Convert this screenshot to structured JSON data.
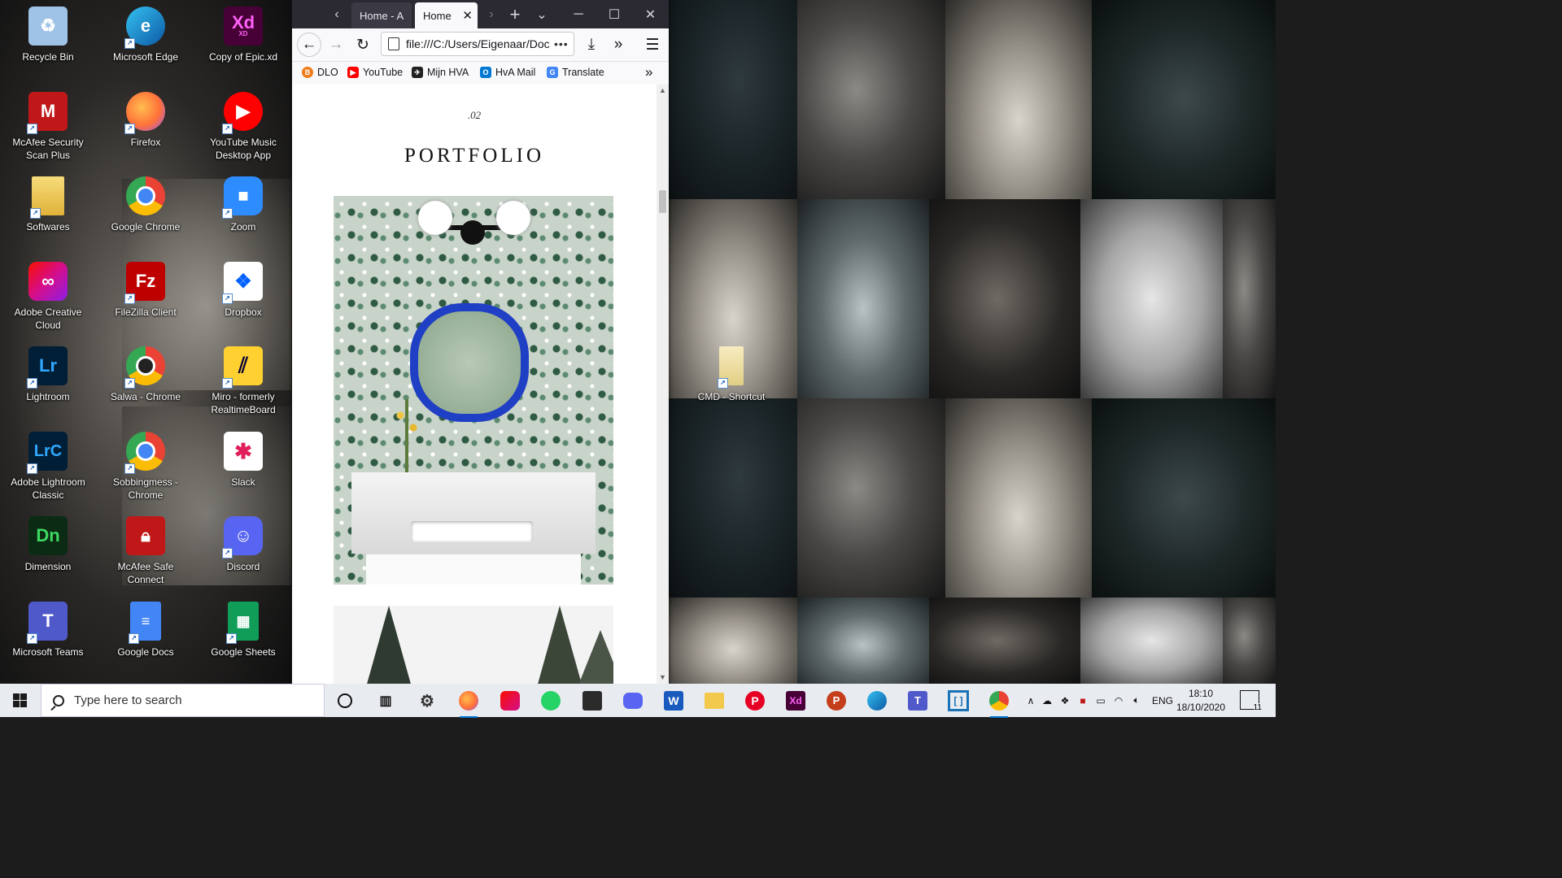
{
  "desktop": {
    "icons": [
      {
        "label": "Recycle Bin",
        "icon": "recycle-bin-icon",
        "color": "#9fc3e6"
      },
      {
        "label": "Microsoft Edge",
        "icon": "edge-icon",
        "color": "#1b8bd6"
      },
      {
        "label": "Copy of Epic.xd",
        "icon": "xd-file-icon",
        "color": "#470137"
      },
      {
        "label": "McAfee Security Scan Plus",
        "icon": "mcafee-scan-icon",
        "color": "#c01818"
      },
      {
        "label": "Firefox",
        "icon": "firefox-icon",
        "color": "#ff7139"
      },
      {
        "label": "YouTube Music Desktop App",
        "icon": "youtube-music-icon",
        "color": "#ff0000"
      },
      {
        "label": "Softwares",
        "icon": "folder-icon",
        "color": "#e8c14b"
      },
      {
        "label": "Google Chrome",
        "icon": "chrome-icon",
        "color": "#4285f4"
      },
      {
        "label": "Zoom",
        "icon": "zoom-icon",
        "color": "#2d8cff"
      },
      {
        "label": "Adobe Creative Cloud",
        "icon": "creative-cloud-icon",
        "color": "#e8375a"
      },
      {
        "label": "FileZilla Client",
        "icon": "filezilla-icon",
        "color": "#bf0000"
      },
      {
        "label": "Dropbox",
        "icon": "dropbox-icon",
        "color": "#0061ff"
      },
      {
        "label": "Lightroom",
        "icon": "lightroom-icon",
        "color": "#001e36"
      },
      {
        "label": "Salwa - Chrome",
        "icon": "chrome-profile-icon",
        "color": "#4285f4"
      },
      {
        "label": "Miro - formerly RealtimeBoard",
        "icon": "miro-icon",
        "color": "#ffd02f"
      },
      {
        "label": "Adobe Lightroom Classic",
        "icon": "lightroom-classic-icon",
        "color": "#001e36"
      },
      {
        "label": "Sobbingmess - Chrome",
        "icon": "chrome-profile-icon",
        "color": "#4285f4"
      },
      {
        "label": "Slack",
        "icon": "slack-icon",
        "color": "#ffffff"
      },
      {
        "label": "Dimension",
        "icon": "dimension-icon",
        "color": "#0b2b14"
      },
      {
        "label": "McAfee Safe Connect",
        "icon": "mcafee-safe-connect-icon",
        "color": "#c01818"
      },
      {
        "label": "Discord",
        "icon": "discord-icon",
        "color": "#5865f2"
      },
      {
        "label": "Microsoft Teams",
        "icon": "teams-icon",
        "color": "#5059c9"
      },
      {
        "label": "Google Docs",
        "icon": "google-docs-icon",
        "color": "#4285f4"
      },
      {
        "label": "Google Sheets",
        "icon": "google-sheets-icon",
        "color": "#0f9d58"
      },
      {
        "label": "CMD - Shortcut",
        "icon": "file-shortcut-icon",
        "color": "#f0e2a0"
      }
    ],
    "icon_glyphs": {
      "xd": "Xd",
      "xd_sub": "XD",
      "lr": "Lr",
      "lrc": "LrC",
      "dn": "Dn",
      "fz": "Fz",
      "t": "T",
      "m": "M"
    }
  },
  "browser": {
    "tabs": [
      {
        "label": "Home - A",
        "active": false
      },
      {
        "label": "Home",
        "active": true
      }
    ],
    "controls": {
      "minimize": "─",
      "maximize": "☐",
      "close": "✕",
      "new_tab": "+",
      "tab_list": "⌄",
      "back_tabs": "‹",
      "fwd_tabs": "›"
    },
    "url": "file:///C:/Users/Eigenaar/Doc",
    "url_menu": "•••",
    "bookmarks": [
      {
        "label": "DLO",
        "icon": "dlo-icon",
        "color": "#f07c1c"
      },
      {
        "label": "YouTube",
        "icon": "youtube-icon",
        "color": "#ff0000"
      },
      {
        "label": "Mijn HVA",
        "icon": "hva-icon",
        "color": "#222222"
      },
      {
        "label": "HvA Mail",
        "icon": "outlook-icon",
        "color": "#0078d4"
      },
      {
        "label": "Translate",
        "icon": "translate-icon",
        "color": "#4285f4"
      }
    ],
    "page": {
      "section_number": ".02",
      "section_title": "PORTFOLIO"
    }
  },
  "taskbar": {
    "search_placeholder": "Type here to search",
    "apps": [
      {
        "name": "cortana",
        "icon": "cortana-icon",
        "color": "#111111"
      },
      {
        "name": "task-view",
        "icon": "task-view-icon",
        "color": "#111111"
      },
      {
        "name": "settings",
        "icon": "gear-icon",
        "color": "#333333"
      },
      {
        "name": "firefox",
        "icon": "firefox-icon",
        "color": "#ff7139",
        "active": true
      },
      {
        "name": "creative-cloud",
        "icon": "creative-cloud-icon",
        "color": "#e8375a"
      },
      {
        "name": "whatsapp",
        "icon": "whatsapp-icon",
        "color": "#25d366"
      },
      {
        "name": "app-dark",
        "icon": "pen-app-icon",
        "color": "#2b2b2b"
      },
      {
        "name": "discord",
        "icon": "discord-icon",
        "color": "#5865f2"
      },
      {
        "name": "word",
        "icon": "word-icon",
        "color": "#185abd"
      },
      {
        "name": "file-explorer",
        "icon": "folder-icon",
        "color": "#f2c94c"
      },
      {
        "name": "pinterest",
        "icon": "pinterest-icon",
        "color": "#e60023"
      },
      {
        "name": "xd",
        "icon": "xd-icon",
        "color": "#470137"
      },
      {
        "name": "powerpoint",
        "icon": "powerpoint-icon",
        "color": "#c43e1c"
      },
      {
        "name": "edge",
        "icon": "edge-icon",
        "color": "#1b8bd6"
      },
      {
        "name": "teams",
        "icon": "teams-icon",
        "color": "#5059c9"
      },
      {
        "name": "bracket-app",
        "icon": "bracket-app-icon",
        "color": "#1a73b8"
      },
      {
        "name": "chrome",
        "icon": "chrome-icon",
        "color": "#4285f4"
      }
    ],
    "tray": {
      "language": "ENG",
      "time": "18:10",
      "date": "18/10/2020",
      "notification_count": "11"
    }
  }
}
